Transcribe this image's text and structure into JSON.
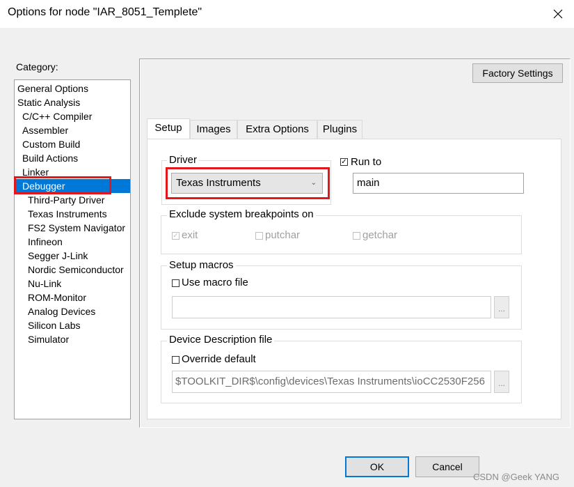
{
  "window": {
    "title": "Options for node \"IAR_8051_Templete\"",
    "close_icon": "close-icon"
  },
  "category": {
    "label": "Category:",
    "items": [
      "General Options",
      "Static Analysis",
      "C/C++ Compiler",
      "Assembler",
      "Custom Build",
      "Build Actions",
      "Linker",
      "Debugger",
      "Third-Party Driver",
      "Texas Instruments",
      "FS2 System Navigator",
      "Infineon",
      "Segger J-Link",
      "Nordic Semiconductor",
      "Nu-Link",
      "ROM-Monitor",
      "Analog Devices",
      "Silicon Labs",
      "Simulator"
    ],
    "selected": "Debugger"
  },
  "factory_button": "Factory Settings",
  "tabs": [
    "Setup",
    "Images",
    "Extra Options",
    "Plugins"
  ],
  "active_tab": "Setup",
  "setup": {
    "driver_label": "Driver",
    "driver_value": "Texas Instruments",
    "run_to_label": "Run to",
    "run_to_checked": true,
    "run_to_value": "main",
    "exclude_label": "Exclude system breakpoints on",
    "exclude_exit": "exit",
    "exclude_putchar": "putchar",
    "exclude_getchar": "getchar",
    "macros_label": "Setup macros",
    "use_macro_label": "Use macro file",
    "macro_file_value": "",
    "ddf_label": "Device Description file",
    "override_label": "Override default",
    "ddf_value": "$TOOLKIT_DIR$\\config\\devices\\Texas Instruments\\ioCC2530F256",
    "browse_label": "..."
  },
  "buttons": {
    "ok": "OK",
    "cancel": "Cancel"
  },
  "watermark": "CSDN @Geek YANG",
  "colors": {
    "selection": "#0078d7",
    "highlight": "#e2161d"
  }
}
